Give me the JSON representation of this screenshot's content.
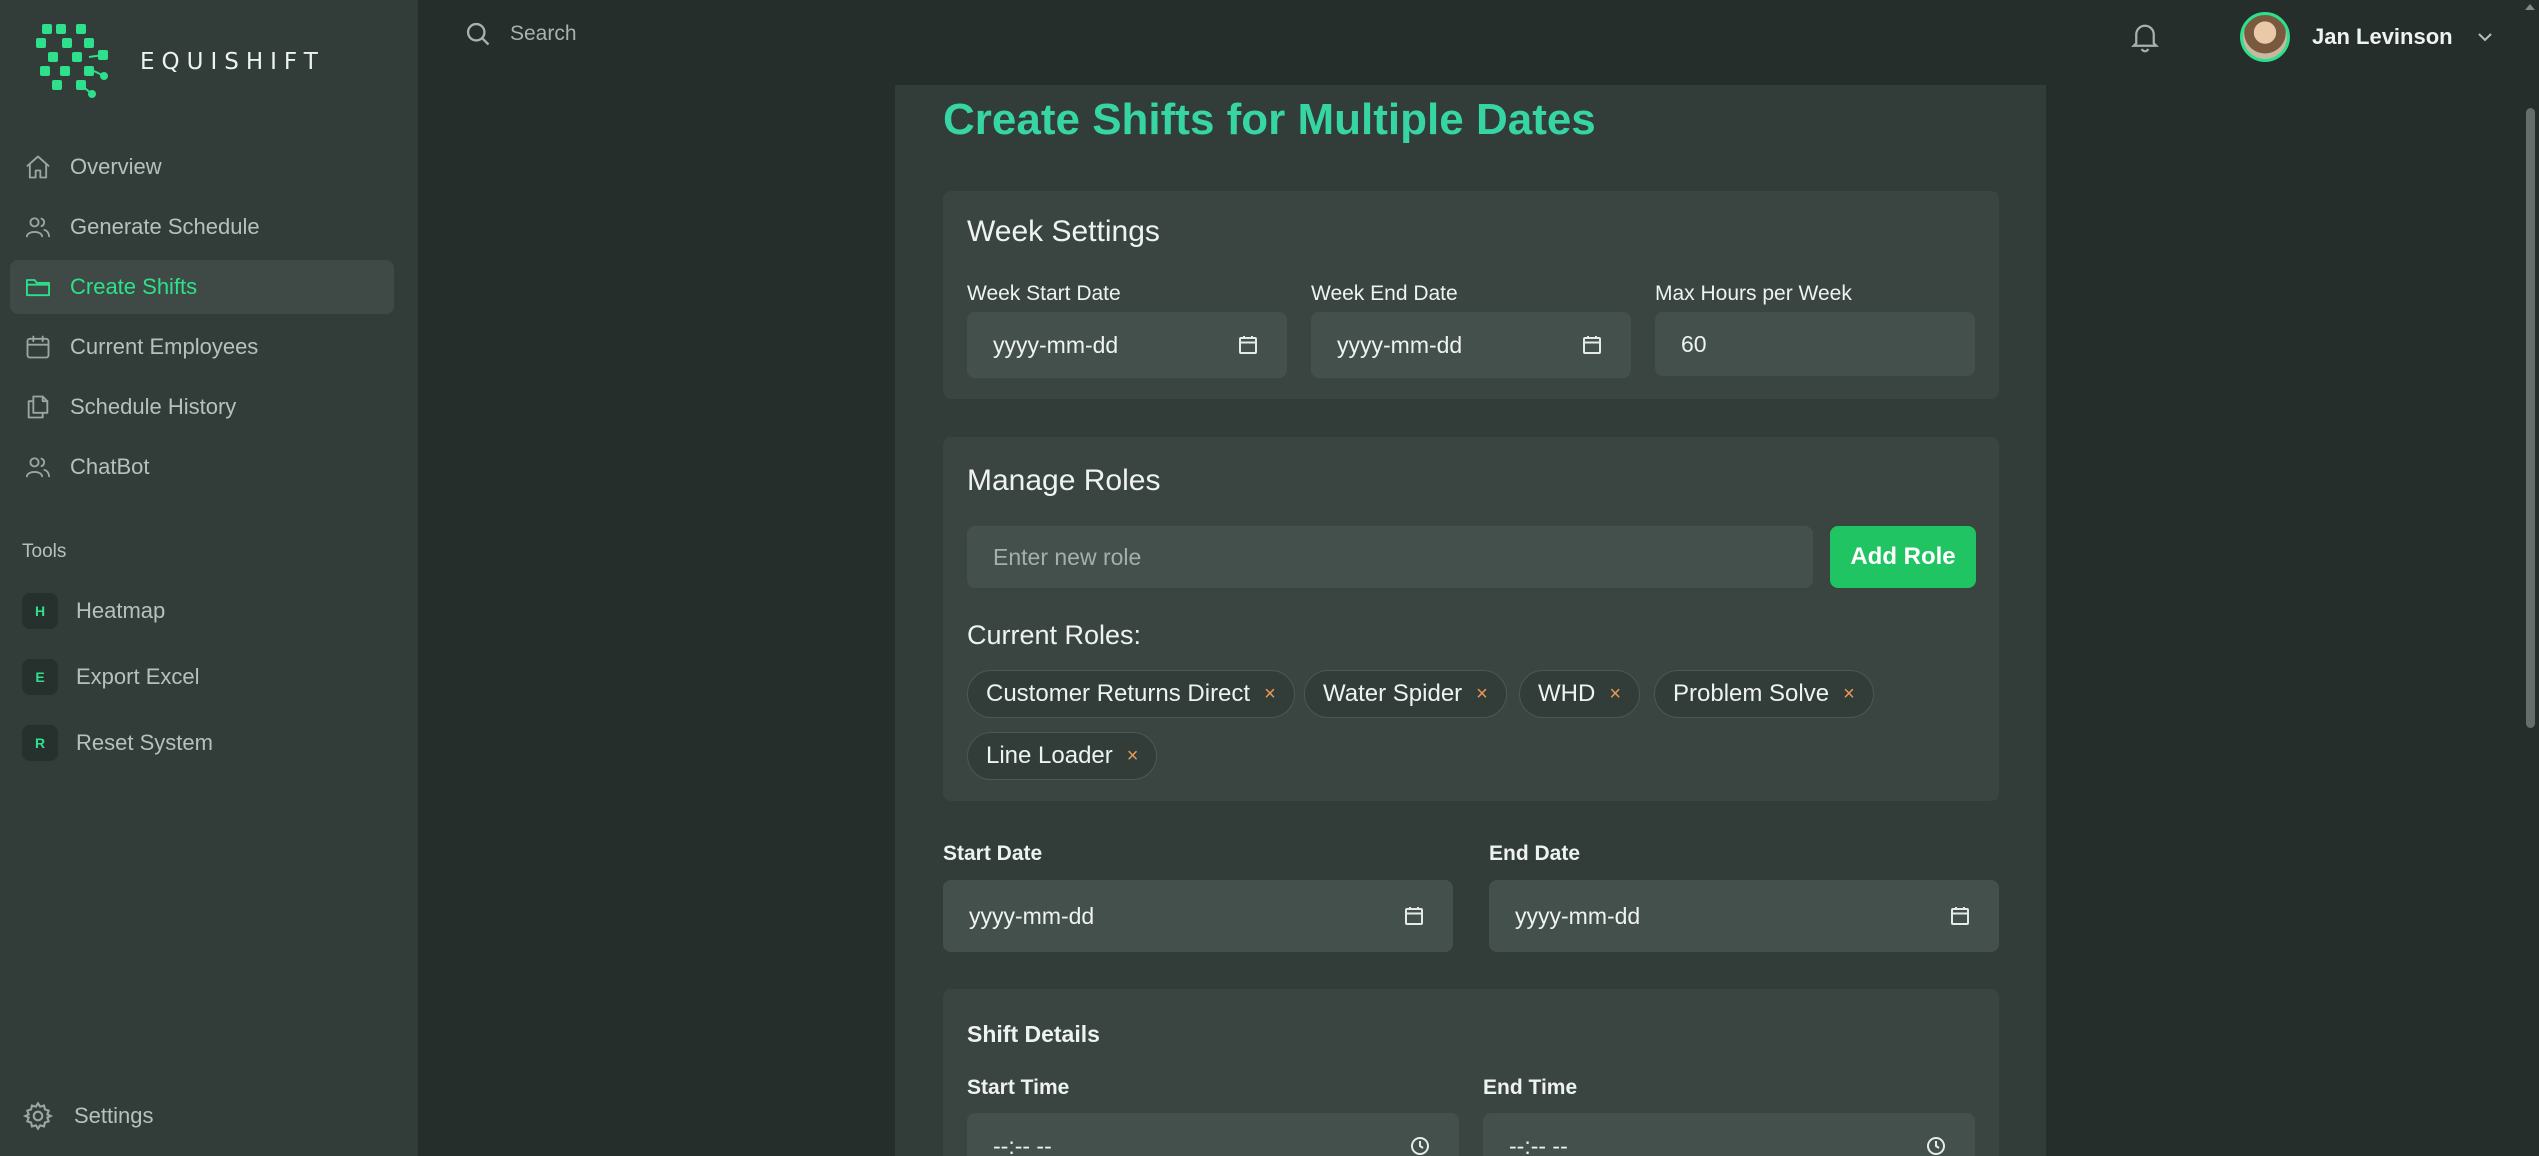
{
  "app": {
    "brand": "EQUISHIFT"
  },
  "sidebar": {
    "items": [
      {
        "label": "Overview",
        "icon": "home-icon",
        "active": false
      },
      {
        "label": "Generate Schedule",
        "icon": "users-icon",
        "active": false
      },
      {
        "label": "Create Shifts",
        "icon": "folder-icon",
        "active": true
      },
      {
        "label": "Current Employees",
        "icon": "calendar-icon",
        "active": false
      },
      {
        "label": "Schedule History",
        "icon": "documents-icon",
        "active": false
      },
      {
        "label": "ChatBot",
        "icon": "users-icon",
        "active": false
      }
    ],
    "tools_title": "Tools",
    "tools": [
      {
        "badge": "H",
        "label": "Heatmap"
      },
      {
        "badge": "E",
        "label": "Export Excel"
      },
      {
        "badge": "R",
        "label": "Reset System"
      }
    ],
    "settings_label": "Settings"
  },
  "topbar": {
    "search_placeholder": "Search",
    "user_name": "Jan Levinson"
  },
  "main": {
    "title": "Create Shifts for Multiple Dates",
    "week_settings": {
      "title": "Week Settings",
      "start_label": "Week Start Date",
      "start_value": "yyyy-mm-dd",
      "end_label": "Week End Date",
      "end_value": "yyyy-mm-dd",
      "max_hours_label": "Max Hours per Week",
      "max_hours_value": "60"
    },
    "manage_roles": {
      "title": "Manage Roles",
      "input_placeholder": "Enter new role",
      "add_button": "Add Role",
      "current_title": "Current Roles:",
      "roles": [
        "Customer Returns Direct",
        "Water Spider",
        "WHD",
        "Problem Solve",
        "Line Loader"
      ],
      "remove_glyph": "×"
    },
    "date_range": {
      "start_label": "Start Date",
      "start_value": "yyyy-mm-dd",
      "end_label": "End Date",
      "end_value": "yyyy-mm-dd"
    },
    "shift_details": {
      "title": "Shift Details",
      "start_time_label": "Start Time",
      "start_time_value": "--:-- --",
      "end_time_label": "End Time",
      "end_time_value": "--:-- --"
    }
  },
  "colors": {
    "accent": "#2ee08c",
    "title": "#36d5a3",
    "add_button": "#21c462",
    "remove": "#e89b55"
  }
}
